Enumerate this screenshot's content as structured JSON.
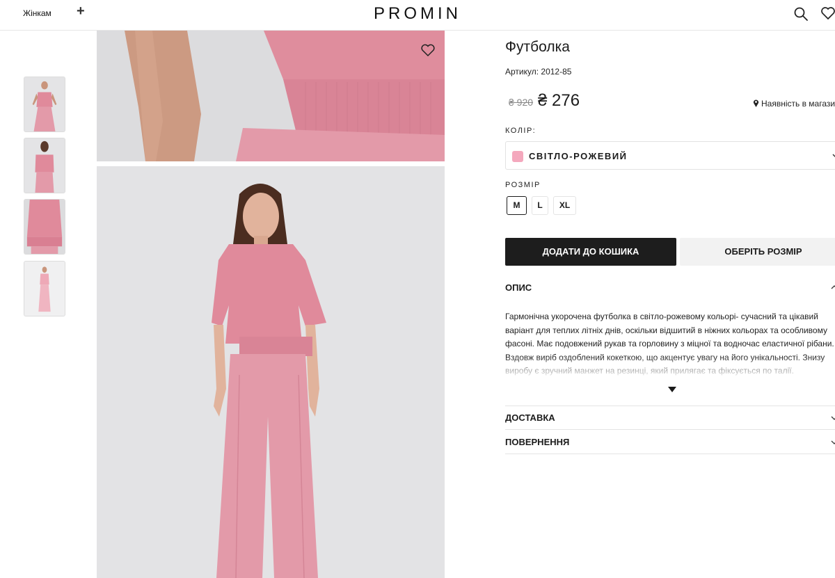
{
  "header": {
    "nav_women": "Жінкам",
    "nav_plus": "+",
    "logo": "PROMIN"
  },
  "product": {
    "title": "Футболка",
    "article": "Артикул: 2012-85",
    "price_old": "₴ 920",
    "price_new": "₴ 276",
    "availability": "Наявність в магазині",
    "color_label": "КОЛІР:",
    "color_value": "СВІТЛО-РОЖЕВИЙ",
    "swatch_color": "#f4a8bd",
    "size_label": "РОЗМІР",
    "sizes": [
      "M",
      "L",
      "XL"
    ],
    "selected_size": "M",
    "add_to_cart": "ДОДАТИ ДО КОШИКА",
    "choose_size": "ОБЕРІТЬ РОЗМІР"
  },
  "accordion": {
    "description_title": "ОПИС",
    "description_text": "Гармонічна укорочена футболка в світло-рожевому кольорі- сучасний та цікавий варіант для теплих літніх днів, оскільки відшитий в ніжних кольорах та особливому фасоні. Має подовжений рукав та горловину з міцної та водночас еластичної рібани. Вздовж виріб оздоблений кокеткою, що акцентує увагу на його унікальності. Знизу виробу є зручний манжет на резинці, який прилягає та фіксується по талії.",
    "delivery_title": "ДОСТАВКА",
    "returns_title": "ПОВЕРНЕННЯ"
  },
  "colors": {
    "accent_dark": "#1d1d1d",
    "garment_pink": "#e08a9b"
  }
}
